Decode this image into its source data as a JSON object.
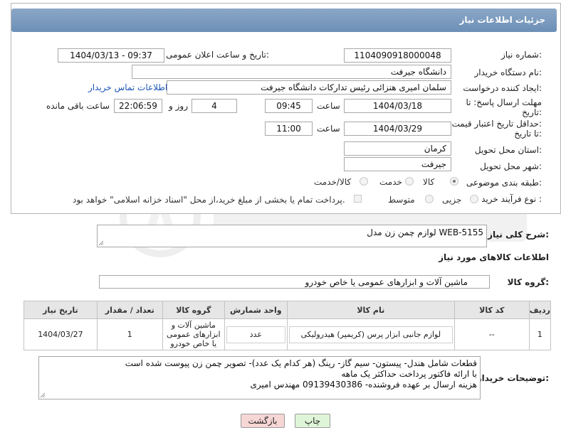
{
  "header": {
    "title": "جزئیات اطلاعات نیاز"
  },
  "fields": {
    "need_number": {
      "label": "شماره نیاز:",
      "value": "1104090918000048"
    },
    "announce_datetime": {
      "label": "تاریخ و ساعت اعلان عمومی:",
      "value": "1404/03/13 - 09:37"
    },
    "buyer_org": {
      "label": "نام دستگاه خریدار:",
      "value": "دانشگاه جیرفت"
    },
    "requester": {
      "label": "ایجاد کننده درخواست:",
      "value": "سلمان امیری هنزائی رئیس تدارکات دانشگاه جیرفت",
      "contact_link": "اطلاعات تماس خریدار"
    },
    "reply_deadline": {
      "label_line1": "مهلت ارسال پاسخ: تا",
      "label_line2": "تاریخ:",
      "date": "1404/03/18",
      "time_label": "ساعت",
      "time": "09:45",
      "days": "4",
      "days_label": "روز و",
      "remaining": "22:06:59",
      "remaining_label": "ساعت باقی مانده"
    },
    "price_validity": {
      "label_line1": "حداقل تاریخ اعتبار قیمت:",
      "label_line2": "تا تاریخ:",
      "date": "1404/03/29",
      "time_label": "ساعت",
      "time": "11:00"
    },
    "delivery_province": {
      "label": "استان محل تحویل:",
      "value": "کرمان"
    },
    "delivery_city": {
      "label": "شهر محل تحویل:",
      "value": "جیرفت"
    },
    "category": {
      "label": "طبقه بندی موضوعی:",
      "options": [
        "کالا",
        "خدمت",
        "کالا/خدمت"
      ],
      "selected": "کالا"
    },
    "process": {
      "label": "نوع فرآیند خرید :",
      "options": [
        "جزیی",
        "متوسط"
      ],
      "note": "پرداخت تمام یا بخشی از مبلغ خرید،از محل \"اسناد خزانه اسلامی\" خواهد بود."
    }
  },
  "summary": {
    "label": "شرح کلی نیاز:",
    "value": "لوازم چمن زن مدل WEB-5155"
  },
  "goods_section": {
    "title": "اطلاعات کالاهای مورد نیاز"
  },
  "goods_group": {
    "label": "گروه کالا:",
    "value": "ماشین آلات و ابزارهای عمومی یا خاص خودرو"
  },
  "table": {
    "headers": [
      "ردیف",
      "کد کالا",
      "نام کالا",
      "واحد شمارش",
      "گروه کالا",
      "تعداد / مقدار",
      "تاریخ نیاز"
    ],
    "rows": [
      {
        "row": "1",
        "code": "--",
        "name": "لوازم جانبی ابزار پرس (کریمپر) هیدرولیکی",
        "unit": "عدد",
        "group": "ماشین آلات و ابزارهای عمومی یا خاص خودرو",
        "qty": "1",
        "date": "1404/03/27"
      }
    ]
  },
  "buyer_notes": {
    "label": "توضیحات خریدار:",
    "lines": [
      "قطعات شامل هندل- پیستون- سیم گاز- رینگ (هر کدام یک عدد)- تصویر چمن زن پیوست شده است",
      "با ارائه فاکتور پرداخت حداکثر یک ماهه",
      "هزینه ارسال بر عهده فروشنده- 09139430386 مهندس امیری"
    ]
  },
  "buttons": {
    "print": "چاپ",
    "back": "بازگشت"
  },
  "colors": {
    "header": "#7a9abf",
    "link": "#1a55b8",
    "print_btn": "#dff5d8",
    "back_btn": "#f7d6d6"
  }
}
